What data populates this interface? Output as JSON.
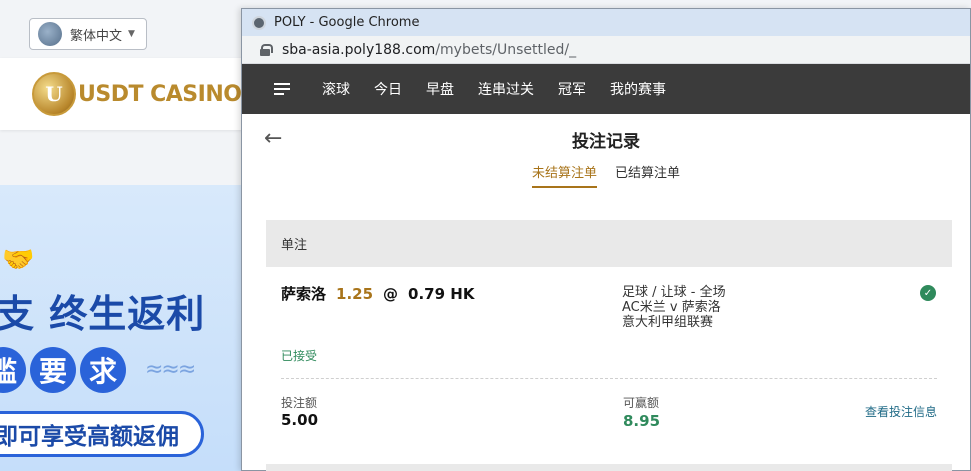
{
  "background_site": {
    "language": "繁体中文",
    "logo_mark": "U",
    "logo_text": "USDT CASINO",
    "promo": {
      "headline": "支 终生返利",
      "pill_chars": [
        "槛",
        "要",
        "求"
      ],
      "button": "即可享受高额返佣"
    }
  },
  "window": {
    "title": "POLY - Google Chrome",
    "url_host": "sba-asia.poly188.com",
    "url_path": "/mybets/Unsettled/_"
  },
  "nav": {
    "items": [
      "滚球",
      "今日",
      "早盘",
      "连串过关",
      "冠军",
      "我的赛事"
    ]
  },
  "page": {
    "title": "投注记录",
    "tabs": [
      {
        "label": "未结算注单",
        "active": true
      },
      {
        "label": "已结算注单",
        "active": false
      }
    ],
    "section_label": "单注"
  },
  "bet": {
    "selection": "萨索洛",
    "odds": "1.25",
    "at": "@",
    "odds_value": "0.79 HK",
    "status": "已接受",
    "market": "足球 / 让球 - 全场",
    "match": "AC米兰 v 萨索洛",
    "league": "意大利甲组联赛",
    "stake_label": "投注额",
    "stake_value": "5.00",
    "win_label": "可赢额",
    "win_value": "8.95",
    "view_info": "查看投注信息"
  },
  "colors": {
    "accent": "#a8741a",
    "success": "#2f8a5c",
    "navbar": "#3b3b3b",
    "link": "#1f6a86"
  }
}
